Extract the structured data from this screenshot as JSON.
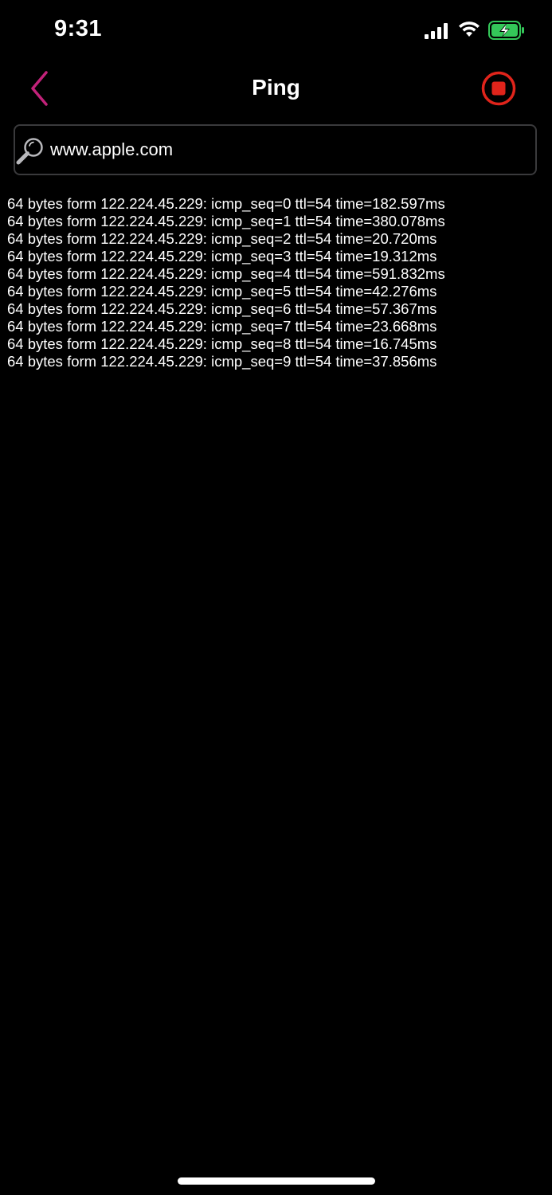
{
  "status_bar": {
    "time": "9:31",
    "icons": [
      "signal-icon",
      "wifi-icon",
      "battery-charging-icon"
    ],
    "battery_color": "#34c759"
  },
  "nav": {
    "title": "Ping",
    "back_icon": "chevron-left-icon",
    "back_color": "#c2227a",
    "stop_icon": "stop-circle-icon",
    "stop_color": "#e0241b"
  },
  "search": {
    "value": "www.apple.com",
    "icon": "search-icon"
  },
  "ping_results": [
    "64 bytes form 122.224.45.229: icmp_seq=0 ttl=54 time=182.597ms",
    "64 bytes form 122.224.45.229: icmp_seq=1 ttl=54 time=380.078ms",
    "64 bytes form 122.224.45.229: icmp_seq=2 ttl=54 time=20.720ms",
    "64 bytes form 122.224.45.229: icmp_seq=3 ttl=54 time=19.312ms",
    "64 bytes form 122.224.45.229: icmp_seq=4 ttl=54 time=591.832ms",
    "64 bytes form 122.224.45.229: icmp_seq=5 ttl=54 time=42.276ms",
    "64 bytes form 122.224.45.229: icmp_seq=6 ttl=54 time=57.367ms",
    "64 bytes form 122.224.45.229: icmp_seq=7 ttl=54 time=23.668ms",
    "64 bytes form 122.224.45.229: icmp_seq=8 ttl=54 time=16.745ms",
    "64 bytes form 122.224.45.229: icmp_seq=9 ttl=54 time=37.856ms"
  ]
}
